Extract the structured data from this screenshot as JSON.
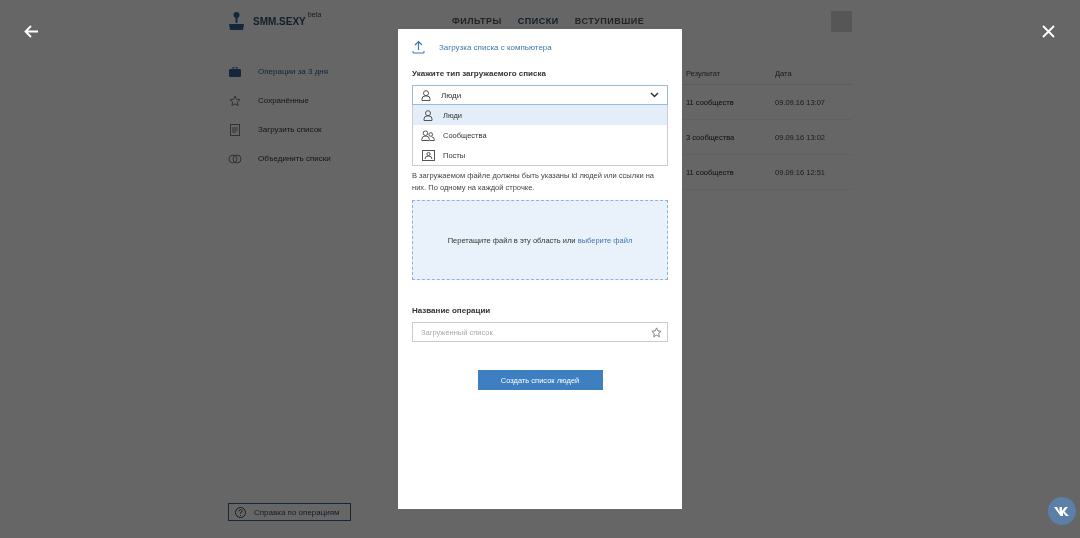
{
  "header": {
    "logo": "SMM.SEXY",
    "badge": "beta",
    "nav": [
      {
        "label": "ФИЛЬТРЫ",
        "selected": false
      },
      {
        "label": "СПИСКИ",
        "selected": true
      },
      {
        "label": "ВСТУПИВШИЕ",
        "selected": false
      }
    ]
  },
  "sidebar": {
    "items": [
      {
        "label": "Операции за 3 дня",
        "selected": true
      },
      {
        "label": "Сохранённые",
        "selected": false
      },
      {
        "label": "Загрузить список",
        "selected": false
      },
      {
        "label": "Объединить списки",
        "selected": false
      }
    ]
  },
  "table": {
    "columns": [
      "Результат",
      "Дата"
    ],
    "rows": [
      [
        "11 сообществ",
        "09.09.16 13:07"
      ],
      [
        "3 сообщества",
        "09.09.16 13:02"
      ],
      [
        "11 сообществ",
        "09.09.16 12:51"
      ]
    ]
  },
  "help_button": "Справка по операциям",
  "modal": {
    "title": "Загрузка списка с компьютера",
    "type_label": "Укажите тип загружаемого списка",
    "select": {
      "value": "Люди",
      "expanded": true
    },
    "options": [
      {
        "label": "Люди",
        "kind": "person",
        "selected": true
      },
      {
        "label": "Сообщества",
        "kind": "group",
        "selected": false
      },
      {
        "label": "Посты",
        "kind": "post",
        "selected": false
      }
    ],
    "hint": "В загружаемом файле должны быть указаны id людей или ссылки на них. По одному на каждой строчке.",
    "dropzone": {
      "text": "Перетащите файл в эту область или",
      "link": "выберите файл"
    },
    "name_label": "Название операции",
    "name_field": {
      "placeholder": "Загруженный список"
    },
    "submit": "Создать список людей"
  }
}
